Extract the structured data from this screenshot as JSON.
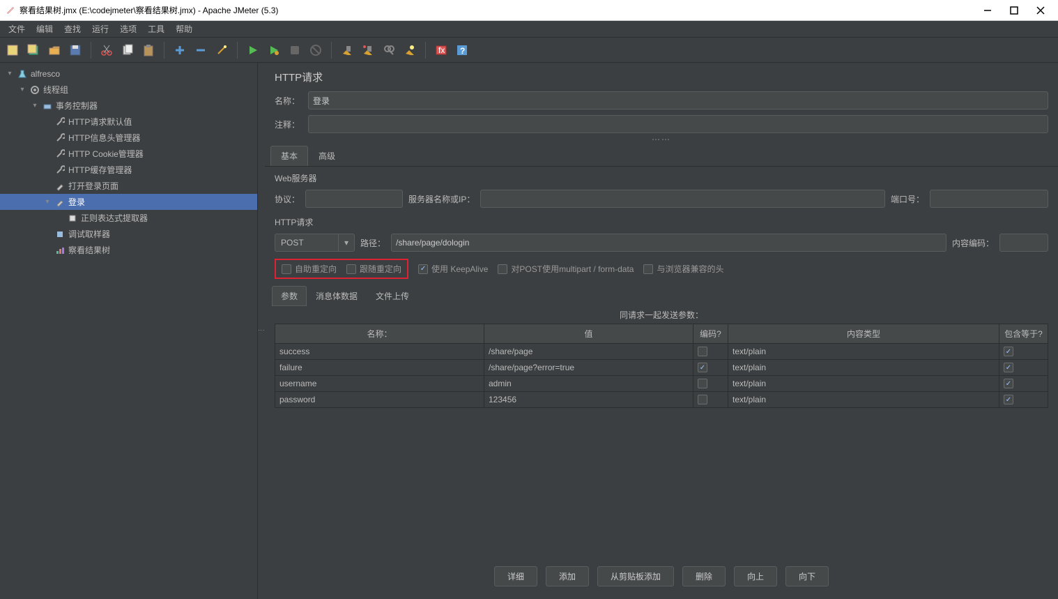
{
  "window": {
    "title": "察看结果树.jmx (E:\\codejmeter\\察看结果树.jmx) - Apache JMeter (5.3)"
  },
  "menu": [
    "文件",
    "编辑",
    "查找",
    "运行",
    "选项",
    "工具",
    "帮助"
  ],
  "tree": {
    "root": "alfresco",
    "thread_group": "线程组",
    "controller": "事务控制器",
    "items": [
      "HTTP请求默认值",
      "HTTP信息头管理器",
      "HTTP Cookie管理器",
      "HTTP缓存管理器",
      "打开登录页面",
      "登录"
    ],
    "login_child": "正则表达式提取器",
    "debug": "调试取样器",
    "results": "察看结果树"
  },
  "panel": {
    "title": "HTTP请求",
    "name_label": "名称：",
    "name_value": "登录",
    "comment_label": "注释：",
    "tab_basic": "基本",
    "tab_adv": "高级",
    "web_server": "Web服务器",
    "protocol": "协议：",
    "server": "服务器名称或IP：",
    "port": "端口号：",
    "http_req": "HTTP请求",
    "method": "POST",
    "path_label": "路径：",
    "path_value": "/share/page/dologin",
    "encoding": "内容编码：",
    "auto_redirect": "自助重定向",
    "follow_redirect": "跟随重定向",
    "keepalive": "使用 KeepAlive",
    "multipart": "对POST使用multipart / form-data",
    "browser_headers": "与浏览器兼容的头",
    "subtab_params": "参数",
    "subtab_body": "消息体数据",
    "subtab_files": "文件上传",
    "params_title": "同请求一起发送参数：",
    "col_name": "名称：",
    "col_value": "值",
    "col_encode": "编码?",
    "col_ctype": "内容类型",
    "col_include": "包含等于?",
    "rows": [
      {
        "name": "success",
        "value": "/share/page",
        "encode": false,
        "ctype": "text/plain",
        "include": true
      },
      {
        "name": "failure",
        "value": "/share/page?error=true",
        "encode": true,
        "ctype": "text/plain",
        "include": true
      },
      {
        "name": "username",
        "value": "admin",
        "encode": false,
        "ctype": "text/plain",
        "include": true
      },
      {
        "name": "password",
        "value": "123456",
        "encode": false,
        "ctype": "text/plain",
        "include": true
      }
    ],
    "buttons": [
      "详细",
      "添加",
      "从剪贴板添加",
      "删除",
      "向上",
      "向下"
    ]
  }
}
